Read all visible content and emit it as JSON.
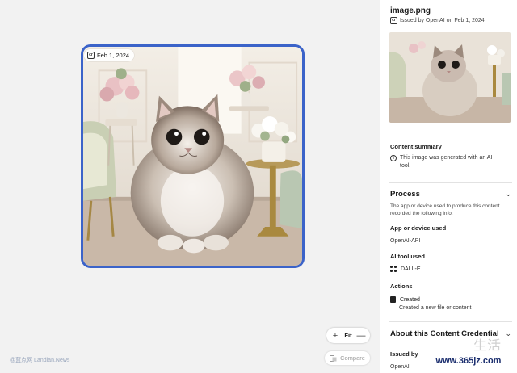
{
  "image": {
    "date_badge": "Feb 1, 2024",
    "cr_icon_glyph": "cr",
    "zoom_in": "+",
    "fit_label": "Fit",
    "zoom_out": "—",
    "compare_label": "Compare",
    "watermark_left": "@蓝点网 Landian.News"
  },
  "panel": {
    "file_name": "image.png",
    "issued_by": "Issued by OpenAI on Feb 1, 2024",
    "content_summary_label": "Content summary",
    "content_summary_text": "This image was generated with an AI tool.",
    "process_title": "Process",
    "process_desc": "The app or device used to produce this content recorded the following info:",
    "app_label": "App or device used",
    "app_value": "OpenAI-API",
    "ai_tool_label": "AI tool used",
    "ai_tool_value": "DALL-E",
    "actions_label": "Actions",
    "action_title": "Created",
    "action_desc": "Created a new file or content",
    "about_title": "About this Content Credential",
    "issued_by_label": "Issued by",
    "issued_by_value": "OpenAI",
    "watermark_right": "www.365jz.com",
    "watermark_stamp": "生活"
  },
  "colors": {
    "accent_border": "#3b63c9",
    "panel_bg": "#ffffff",
    "canvas_bg": "#f2f2f2"
  },
  "icons": [
    "cr-icon",
    "info-icon",
    "chevron-down-icon",
    "plus-icon",
    "minus-icon",
    "compare-icon",
    "dalle-icon",
    "created-icon"
  ]
}
